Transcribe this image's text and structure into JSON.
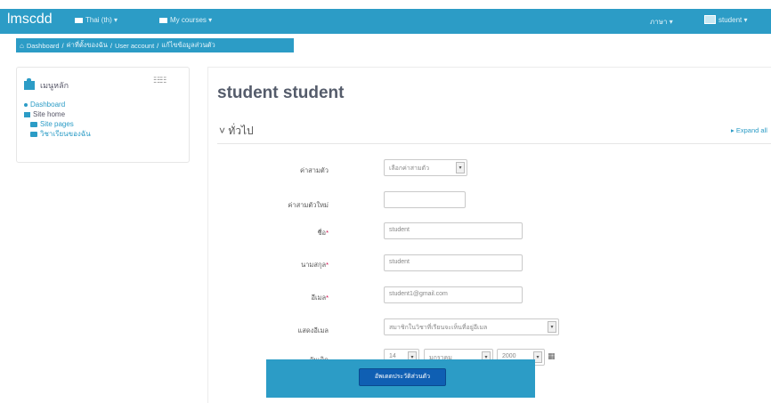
{
  "navbar": {
    "brand": "lmscdd",
    "menus": [
      {
        "label": "Thai (th) ▾",
        "icon": "flag-icon"
      },
      {
        "label": "My courses ▾",
        "icon": "courses-icon"
      }
    ],
    "right_menu_label": "ภาษา ▾",
    "user_label": "student ▾"
  },
  "breadcrumb": [
    "Dashboard",
    "ค่าที่ตั้งของฉัน",
    "User account",
    "แก้ไขข้อมูลส่วนตัว"
  ],
  "block": {
    "title": "เมนูหลัก",
    "dock_icon_glyph": "☷☷",
    "items": [
      {
        "label": "Dashboard",
        "level": 1,
        "icon": "dot"
      },
      {
        "label": "Site home",
        "level": 1,
        "icon": "square"
      },
      {
        "label": "Site pages",
        "level": 2,
        "icon": "folder"
      },
      {
        "label": "วิชาเรียนของฉัน",
        "level": 2,
        "icon": "folder"
      }
    ]
  },
  "main": {
    "title": "student student",
    "expand_all": "Expand all",
    "legend": "ทั่วไป",
    "form": {
      "auth_label": "ค่าสามตัว",
      "auth_value": "เลือกค่าสามตัว",
      "newpassword_label": "ค่าสามตัวใหม่",
      "newpassword_value": "",
      "firstname_label": "ชื่อ",
      "firstname_value": "student",
      "lastname_label": "นามสกุล",
      "lastname_value": "student",
      "email_label": "อีเมล",
      "email_value": "student1@gmail.com",
      "emaildisplay_label": "แสดงอีเมล",
      "emaildisplay_value": "สมาชิกในวิชาที่เรียนจะเห็นที่อยู่อีเมล",
      "date_label": "วันเกิด",
      "date_day": "14",
      "date_month": "มกราคม",
      "date_year": "2000"
    },
    "submit_label": "อัพเดตประวัติส่วนตัว"
  },
  "colors": {
    "brand": "#2c9cc6",
    "button": "#0f5fb3"
  }
}
